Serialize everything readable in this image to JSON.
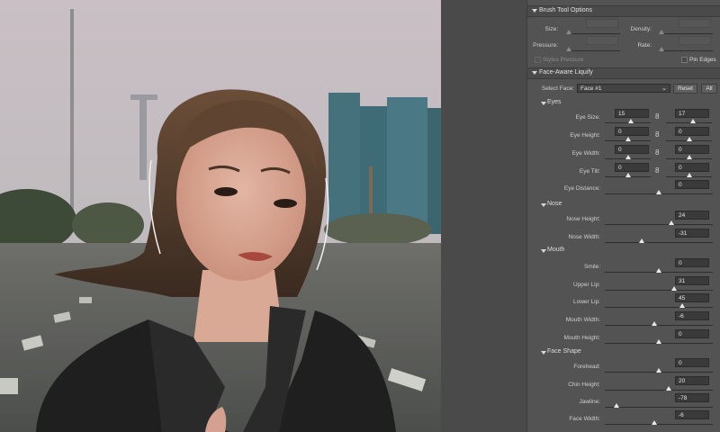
{
  "colors": {
    "panel_bg": "#535353",
    "header_bg": "#4a4a4a",
    "field_bg": "#3a3a3a"
  },
  "brush_tool_options": {
    "header": "Brush Tool Options",
    "size_label": "Size:",
    "density_label": "Density:",
    "pressure_label": "Pressure:",
    "rate_label": "Rate:",
    "stylus_pressure_label": "Stylus Pressure",
    "pin_edges_label": "Pin Edges"
  },
  "face_aware": {
    "header": "Face-Aware Liquify",
    "select_face_label": "Select Face:",
    "select_face_value": "Face #1",
    "reset_label": "Reset",
    "all_label": "All",
    "eyes": {
      "header": "Eyes",
      "size_label": "Eye Size:",
      "size_left": "15",
      "size_right": "17",
      "height_label": "Eye Height:",
      "height_left": "0",
      "height_right": "0",
      "width_label": "Eye Width:",
      "width_left": "0",
      "width_right": "0",
      "tilt_label": "Eye Tilt:",
      "tilt_left": "0",
      "tilt_right": "0",
      "distance_label": "Eye Distance:",
      "distance": "0"
    },
    "nose": {
      "header": "Nose",
      "height_label": "Nose Height:",
      "height": "24",
      "width_label": "Nose Width:",
      "width": "-31"
    },
    "mouth": {
      "header": "Mouth",
      "smile_label": "Smile:",
      "smile": "0",
      "upper_lip_label": "Upper Lip:",
      "upper_lip": "31",
      "lower_lip_label": "Lower Lip:",
      "lower_lip": "45",
      "width_label": "Mouth Width:",
      "width": "-6",
      "height_label": "Mouth Height:",
      "height": "0"
    },
    "face_shape": {
      "header": "Face Shape",
      "forehead_label": "Forehead:",
      "forehead": "0",
      "chin_height_label": "Chin Height:",
      "chin_height": "20",
      "jawline_label": "Jawline:",
      "jawline": "-78",
      "face_width_label": "Face Width:",
      "face_width": "-6"
    }
  },
  "icons": {
    "link": "chain-link-icon",
    "collapse": "triangle-down-icon",
    "dropdown": "chevron-down-icon"
  }
}
